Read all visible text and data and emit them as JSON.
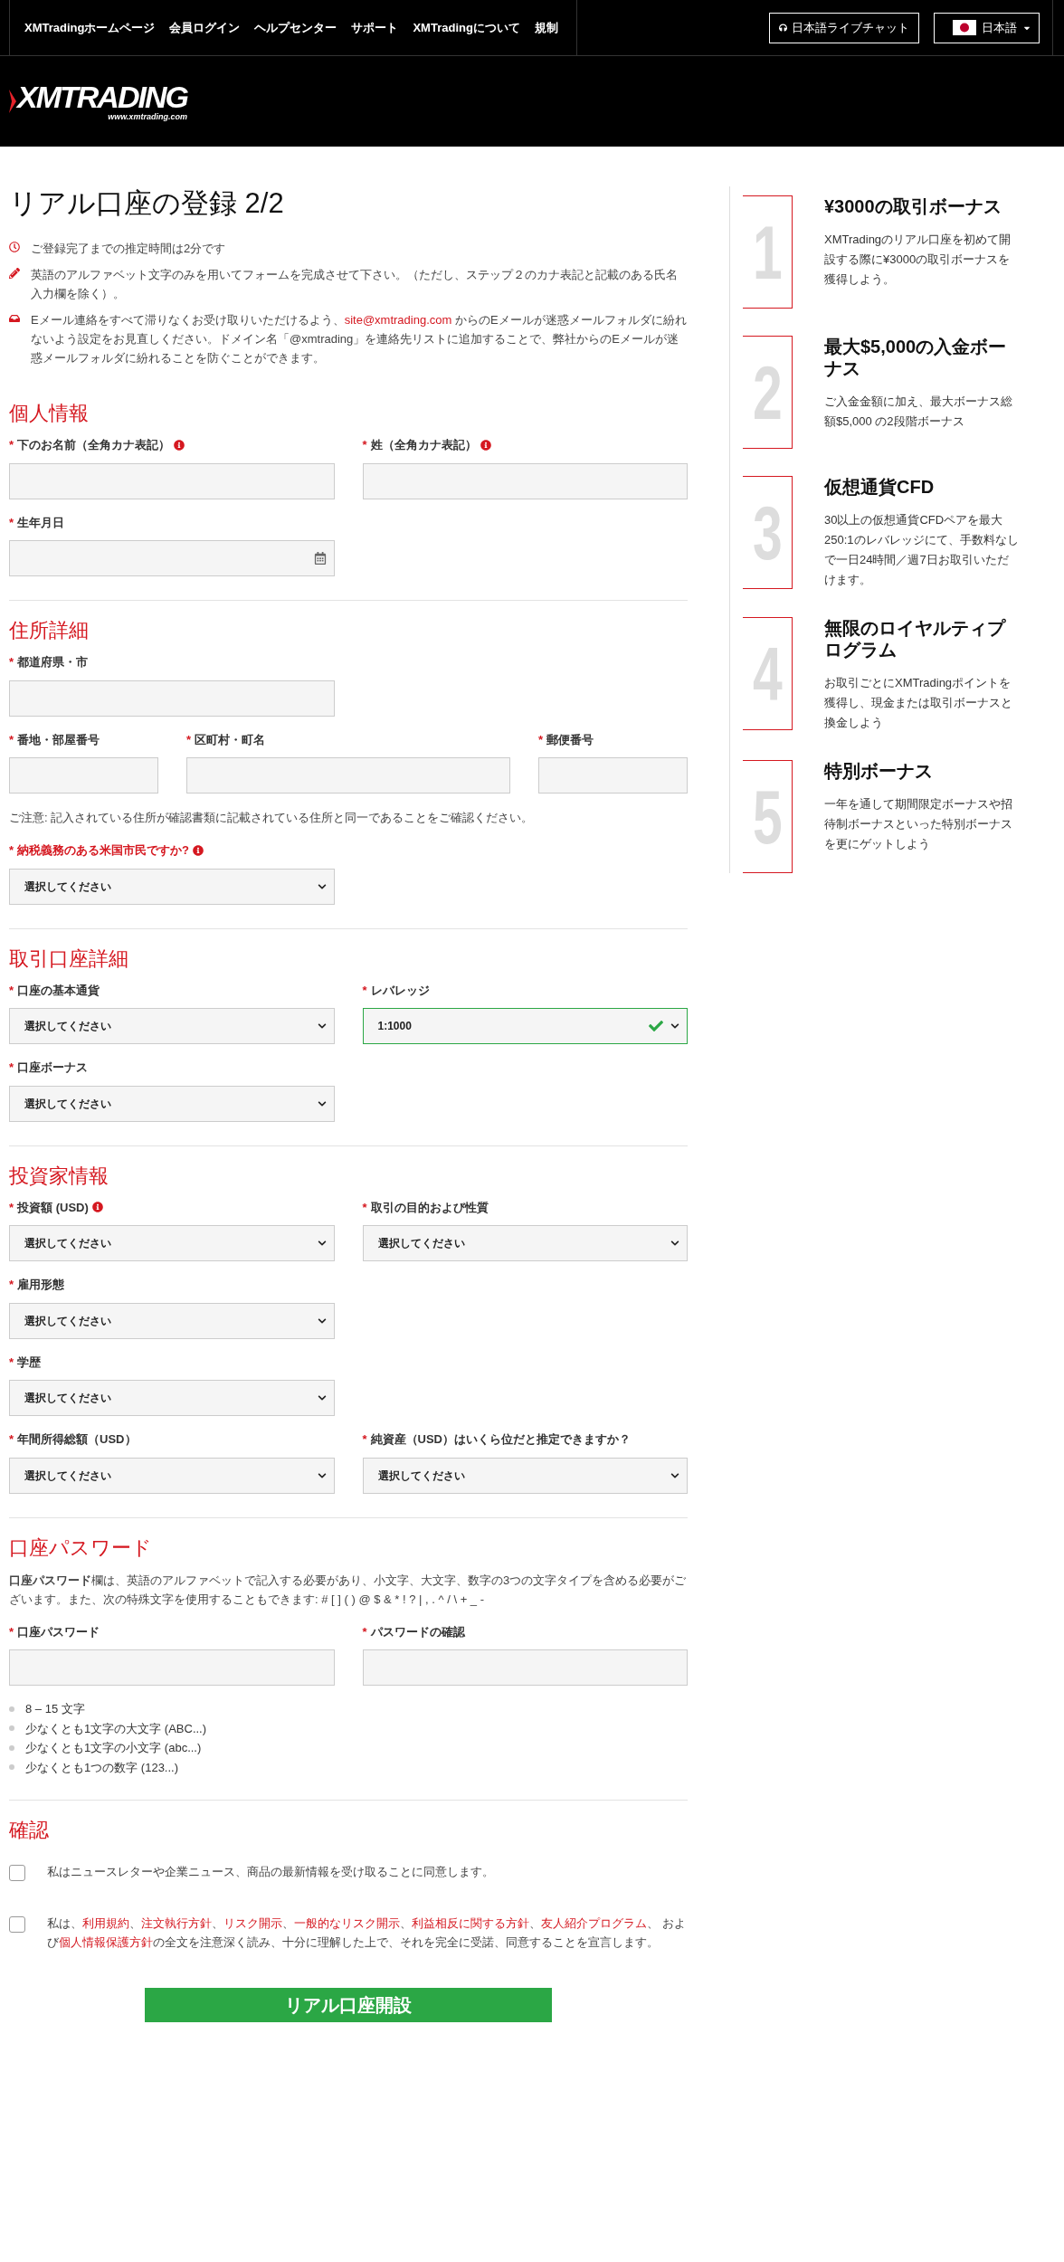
{
  "top_nav": {
    "links": [
      "XMTradingホームページ",
      "会員ログイン",
      "ヘルプセンター",
      "サポート",
      "XMTradingについて",
      "規制"
    ],
    "chat_button": "日本語ライブチャット",
    "language_button": "日本語"
  },
  "logo": {
    "text": "XMTRADING",
    "url": "www.xmtrading.com"
  },
  "page_title": "リアル口座の登録 2/2",
  "intro": [
    {
      "kind": "time",
      "parts": [
        {
          "text": "ご登録完了までの推定時間は2分です",
          "link": false
        }
      ]
    },
    {
      "kind": "edit",
      "parts": [
        {
          "text": "英語のアルファベット文字のみを用いてフォームを完成させて下さい。（ただし、ステップ２のカナ表記と記載のある氏名入力欄を除く）。",
          "link": false
        }
      ]
    },
    {
      "kind": "mail",
      "parts": [
        {
          "text": "Eメール連絡をすべて滞りなくお受け取りいただけるよう、",
          "link": false
        },
        {
          "text": "site@xmtrading.com",
          "link": true
        },
        {
          "text": " からのEメールが迷惑メールフォルダに紛れないよう設定をお見直しください。ドメイン名「@xmtrading」を連絡先リストに追加することで、弊社からのEメールが迷惑メールフォルダに紛れることを防ぐことができます。",
          "link": false
        }
      ]
    }
  ],
  "sections": [
    {
      "title": "個人情報",
      "blocks": [
        {
          "kind": "fields",
          "fields": [
            {
              "asterisk": "*",
              "label": "下のお名前（全角カナ表記）",
              "info": true,
              "error": false,
              "kind": "text"
            },
            {
              "asterisk": "*",
              "label": "姓（全角カナ表記）",
              "info": true,
              "error": false,
              "kind": "text"
            }
          ]
        },
        {
          "kind": "fields",
          "fields": [
            {
              "asterisk": "*",
              "label": "生年月日",
              "info": false,
              "error": false,
              "kind": "date"
            }
          ]
        }
      ]
    },
    {
      "title": "住所詳細",
      "blocks": [
        {
          "kind": "fields",
          "fields": [
            {
              "asterisk": "*",
              "label": "都道府県・市",
              "info": false,
              "error": false,
              "kind": "text"
            }
          ]
        },
        {
          "kind": "fields",
          "fields": [
            {
              "asterisk": "*",
              "label": "番地・部屋番号",
              "info": false,
              "error": false,
              "kind": "text"
            },
            {
              "asterisk": "*",
              "label": "区町村・町名",
              "info": false,
              "error": false,
              "kind": "text"
            },
            {
              "asterisk": "*",
              "label": "郵便番号",
              "info": false,
              "error": false,
              "kind": "text"
            }
          ]
        },
        {
          "kind": "note",
          "text": "ご注意: 記入されている住所が確認書類に記載されている住所と同一であることをご確認ください。"
        },
        {
          "kind": "fields",
          "fields": [
            {
              "asterisk": "*",
              "label": "納税義務のある米国市民ですか?",
              "info": true,
              "error": true,
              "kind": "select",
              "value": "選択してください",
              "valid": false
            }
          ]
        }
      ]
    },
    {
      "title": "取引口座詳細",
      "blocks": [
        {
          "kind": "fields",
          "fields": [
            {
              "asterisk": "*",
              "label": "口座の基本通貨",
              "info": false,
              "error": false,
              "kind": "select",
              "value": "選択してください",
              "valid": false
            },
            {
              "asterisk": "*",
              "label": "レバレッジ",
              "info": false,
              "error": false,
              "kind": "select",
              "value": "1:1000",
              "valid": true
            }
          ]
        },
        {
          "kind": "fields",
          "fields": [
            {
              "asterisk": "*",
              "label": "口座ボーナス",
              "info": false,
              "error": false,
              "kind": "select",
              "value": "選択してください",
              "valid": false
            }
          ]
        }
      ]
    },
    {
      "title": "投資家情報",
      "blocks": [
        {
          "kind": "fields",
          "fields": [
            {
              "asterisk": "*",
              "label": "投資額 (USD)",
              "info": true,
              "error": false,
              "kind": "select",
              "value": "選択してください",
              "valid": false
            },
            {
              "asterisk": "*",
              "label": "取引の目的および性質",
              "info": false,
              "error": false,
              "kind": "select",
              "value": "選択してください",
              "valid": false
            }
          ]
        },
        {
          "kind": "fields",
          "fields": [
            {
              "asterisk": "*",
              "label": "雇用形態",
              "info": false,
              "error": false,
              "kind": "select",
              "value": "選択してください",
              "valid": false
            }
          ]
        },
        {
          "kind": "fields",
          "fields": [
            {
              "asterisk": "*",
              "label": "学歴",
              "info": false,
              "error": false,
              "kind": "select",
              "value": "選択してください",
              "valid": false
            }
          ]
        },
        {
          "kind": "fields",
          "fields": [
            {
              "asterisk": "*",
              "label": "年間所得総額（USD）",
              "info": false,
              "error": false,
              "kind": "select",
              "value": "選択してください",
              "valid": false
            },
            {
              "asterisk": "*",
              "label": "純資産（USD）はいくら位だと推定できますか？",
              "info": false,
              "error": false,
              "kind": "select",
              "value": "選択してください",
              "valid": false
            }
          ]
        }
      ]
    },
    {
      "title": "口座パスワード",
      "blocks": [
        {
          "kind": "note",
          "text": "**口座パスワード**欄は、英語のアルファベットで記入する必要があり、小文字、大文字、数字の3つの文字タイプを含める必要がございます。また、次の特殊文字を使用することもできます: # [ ] ( ) @ $ & * ! ? | , . ^ / \\ + _ -"
        },
        {
          "kind": "fields",
          "fields": [
            {
              "asterisk": "*",
              "label": "口座パスワード",
              "info": false,
              "error": false,
              "kind": "text"
            },
            {
              "asterisk": "*",
              "label": "パスワードの確認",
              "info": false,
              "error": false,
              "kind": "text"
            }
          ]
        },
        {
          "kind": "rules",
          "items": [
            "8 – 15 文字",
            "少なくとも1文字の大文字 (ABC...)",
            "少なくとも1文字の小文字 (abc...)",
            "少なくとも1つの数字 (123...)"
          ]
        }
      ]
    },
    {
      "title": "確認",
      "blocks": [
        {
          "kind": "checkbox",
          "checked": false,
          "parts": [
            {
              "text": "私はニュースレターや企業ニュース、商品の最新情報を受け取ることに同意します。",
              "link": false
            }
          ]
        },
        {
          "kind": "checkbox",
          "checked": false,
          "parts": [
            {
              "text": "私は、",
              "link": false
            },
            {
              "text": "利用規約",
              "link": true
            },
            {
              "text": "、",
              "link": false
            },
            {
              "text": "注文執行方針",
              "link": true
            },
            {
              "text": "、",
              "link": false
            },
            {
              "text": "リスク開示",
              "link": true
            },
            {
              "text": "、",
              "link": false
            },
            {
              "text": "一般的なリスク開示",
              "link": true
            },
            {
              "text": "、",
              "link": false
            },
            {
              "text": "利益相反に関する方針",
              "link": true
            },
            {
              "text": "、",
              "link": false
            },
            {
              "text": "友人紹介プログラム",
              "link": true
            },
            {
              "text": "、 および",
              "link": false
            },
            {
              "text": "個人情報保護方針",
              "link": true
            },
            {
              "text": "の全文を注意深く読み、十分に理解した上で、それを完全に受諾、同意することを宣言します。",
              "link": false
            }
          ]
        }
      ]
    }
  ],
  "submit_button": "リアル口座開設",
  "benefits": [
    {
      "number": "1",
      "title": "¥3000の取引ボーナス",
      "text": "XMTradingのリアル口座を初めて開設する際に¥3000の取引ボーナスを獲得しよう。"
    },
    {
      "number": "2",
      "title": "最大$5,000の入金ボーナス",
      "text": "ご入金金額に加え、最大ボーナス総額$5,000 の2段階ボーナス"
    },
    {
      "number": "3",
      "title": "仮想通貨CFD",
      "text": "30以上の仮想通貨CFDペアを最大250:1のレバレッジにて、手数料なしで一日24時間／週7日お取引いただけます。"
    },
    {
      "number": "4",
      "title": "無限のロイヤルティプログラム",
      "text": "お取引ごとにXMTradingポイントを獲得し、現金または取引ボーナスと換金しよう"
    },
    {
      "number": "5",
      "title": "特別ボーナス",
      "text": "一年を通して期間限定ボーナスや招待制ボーナスといった特別ボーナスを更にゲットしよう"
    }
  ]
}
